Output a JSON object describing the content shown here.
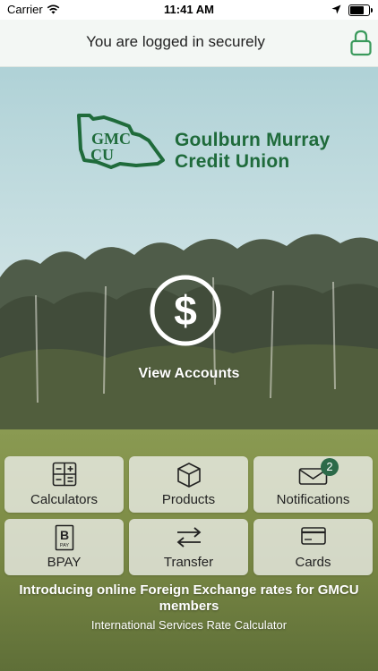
{
  "status_bar": {
    "carrier": "Carrier",
    "time": "11:41 AM",
    "battery_level": 0.85
  },
  "secure_banner": {
    "text": "You are logged in securely",
    "icon": "lock-icon"
  },
  "logo": {
    "mark": "GMCU",
    "name_line1": "Goulburn Murray",
    "name_line2": "Credit Union"
  },
  "main_action": {
    "icon": "dollar-icon",
    "label": "View Accounts"
  },
  "tiles": [
    {
      "label": "Calculators",
      "icon": "calculator-icon"
    },
    {
      "label": "Products",
      "icon": "box-icon"
    },
    {
      "label": "Notifications",
      "icon": "envelope-icon",
      "badge": "2"
    },
    {
      "label": "BPAY",
      "icon": "bpay-icon",
      "icon_text": "PAY"
    },
    {
      "label": "Transfer",
      "icon": "transfer-arrows-icon"
    },
    {
      "label": "Cards",
      "icon": "card-icon"
    }
  ],
  "promo": {
    "headline": "Introducing online Foreign Exchange rates for GMCU members",
    "link": "International Services Rate Calculator"
  },
  "colors": {
    "brand_green": "#1f6b3b",
    "badge_green": "#2c6a49",
    "lock_green": "#3a9a5c"
  }
}
